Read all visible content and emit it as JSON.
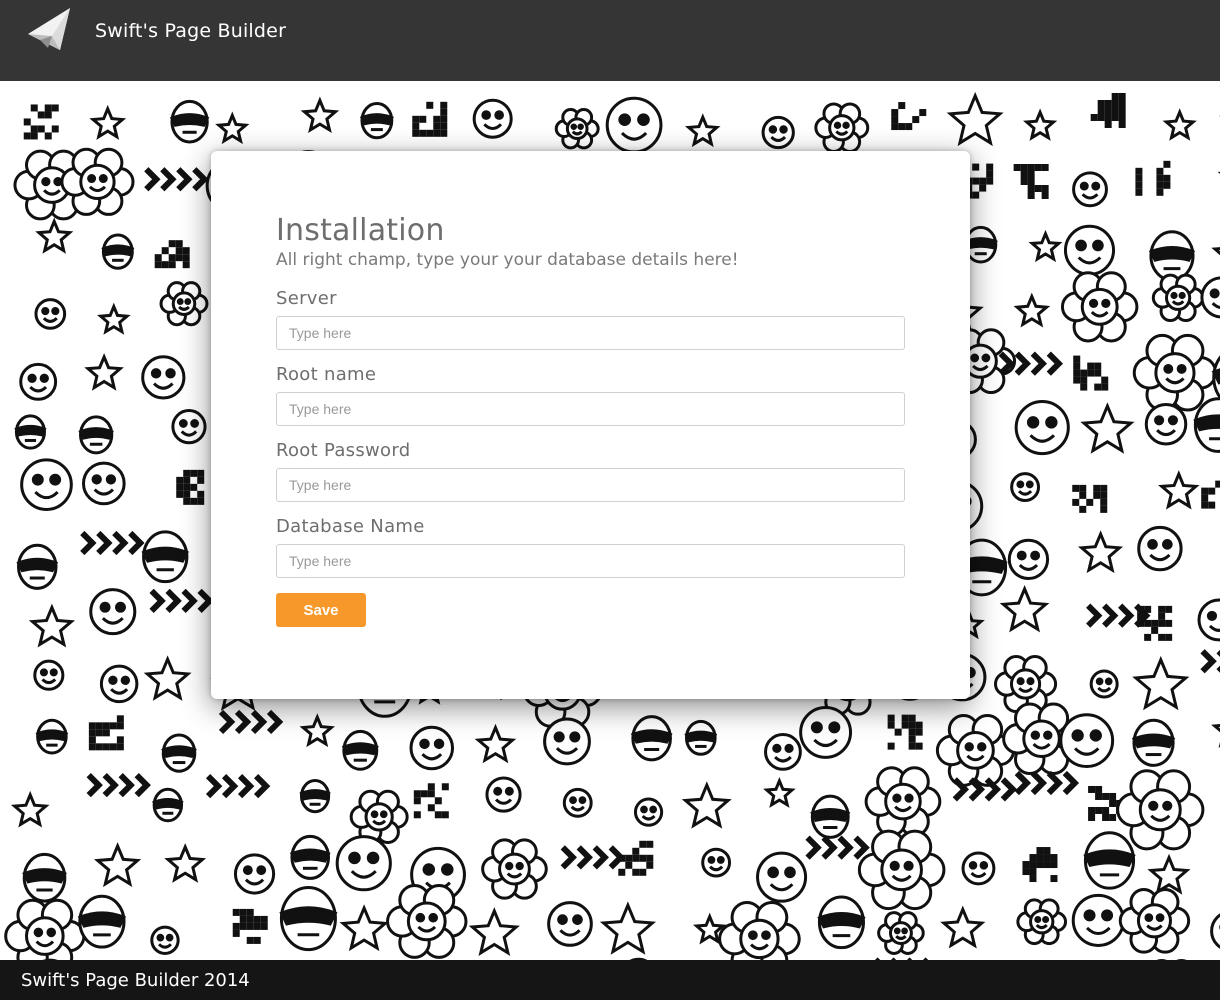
{
  "header": {
    "brand": "Swift's Page Builder",
    "logo_icon": "paper-plane-icon"
  },
  "card": {
    "title": "Installation",
    "subtitle": "All right champ, type your your database details here!",
    "fields": [
      {
        "label": "Server",
        "placeholder": "Type here",
        "value": ""
      },
      {
        "label": "Root name",
        "placeholder": "Type here",
        "value": ""
      },
      {
        "label": "Root Password",
        "placeholder": "Type here",
        "value": ""
      },
      {
        "label": "Database Name",
        "placeholder": "Type here",
        "value": ""
      }
    ],
    "save_label": "Save"
  },
  "footer": {
    "text": "Swift's Page Builder 2014"
  },
  "colors": {
    "header_bg": "#353535",
    "footer_bg": "#151515",
    "accent": "#f7982b",
    "card_bg": "#ffffff"
  }
}
